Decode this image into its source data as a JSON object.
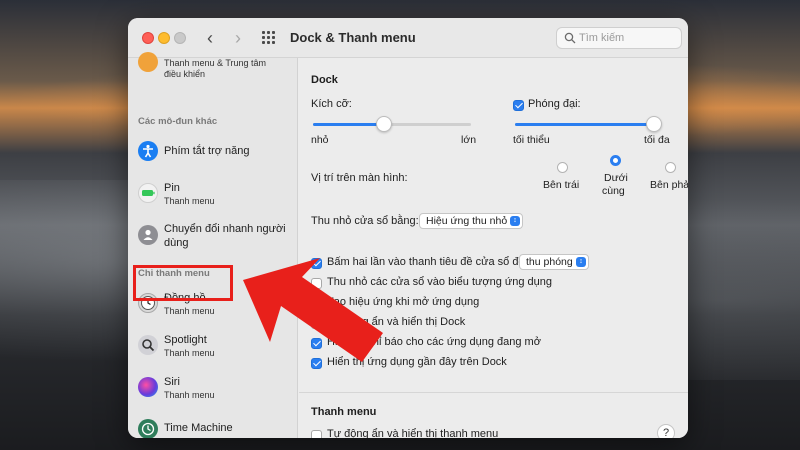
{
  "window": {
    "title": "Dock & Thanh menu",
    "search_placeholder": "Tìm kiếm"
  },
  "sidebar": {
    "top_item_sub1": "Thanh menu & Trung tâm",
    "top_item_sub2": "điều khiển",
    "section_other": "Các mô-đun khác",
    "section_menu_only": "Chỉ thanh menu",
    "items": [
      {
        "title": "Phím tắt trợ năng",
        "sub": "",
        "icon": "accessibility-icon",
        "color": "#1a7ef2"
      },
      {
        "title": "Pin",
        "sub": "Thanh menu",
        "icon": "battery-icon",
        "color": "#34c759"
      },
      {
        "title": "Chuyển đổi nhanh người",
        "title2": "dùng",
        "sub": "",
        "icon": "user-switch-icon",
        "color": "#8e8e93"
      },
      {
        "title": "Đồng hồ",
        "sub": "Thanh menu",
        "icon": "clock-icon",
        "color": "#6b6b6b"
      },
      {
        "title": "Spotlight",
        "sub": "Thanh menu",
        "icon": "spotlight-icon",
        "color": "#6d6d72"
      },
      {
        "title": "Siri",
        "sub": "Thanh menu",
        "icon": "siri-icon",
        "color": "#6a3bdb"
      },
      {
        "title": "Time Machine",
        "sub": "",
        "icon": "time-machine-icon",
        "color": "#2f7d5b"
      }
    ]
  },
  "dock": {
    "heading": "Dock",
    "size_label": "Kích cỡ:",
    "size_min": "nhỏ",
    "size_max": "lớn",
    "size_value": 0.45,
    "magnify_label": "Phóng đại:",
    "magnify_checked": true,
    "magnify_min": "tối thiểu",
    "magnify_max": "tối đa",
    "magnify_value": 0.95,
    "position_label": "Vị trí trên màn hình:",
    "position_options": [
      "Bên trái",
      "Dưới",
      "cùng",
      "Bên phải"
    ],
    "position_selected": "Dưới cùng",
    "minimize_label": "Thu nhỏ cửa sổ bằng:",
    "minimize_value": "Hiệu ứng thu nhỏ",
    "doubleclick_label": "Bấm hai lần vào thanh tiêu đề cửa sổ để",
    "doubleclick_value": "thu phóng",
    "options": [
      {
        "label": "Thu nhỏ các cửa sổ vào biểu tượng ứng dụng",
        "checked": false
      },
      {
        "label": "Tạo hiệu ứng khi mở ứng dụng",
        "checked": true
      },
      {
        "label": "Tự động ẩn và hiển thị Dock",
        "checked": false
      },
      {
        "label": "Hiển thị chỉ báo cho các ứng dụng đang mở",
        "checked": true
      },
      {
        "label": "Hiển thị ứng dụng gần đây trên Dock",
        "checked": true
      }
    ]
  },
  "menubar": {
    "heading": "Thanh menu",
    "autohide_label": "Tự động ẩn và hiển thị thanh menu",
    "autohide_checked": false,
    "help_label": "?"
  },
  "colors": {
    "accent": "#2a7ef0",
    "annotation_red": "#e8201b"
  }
}
